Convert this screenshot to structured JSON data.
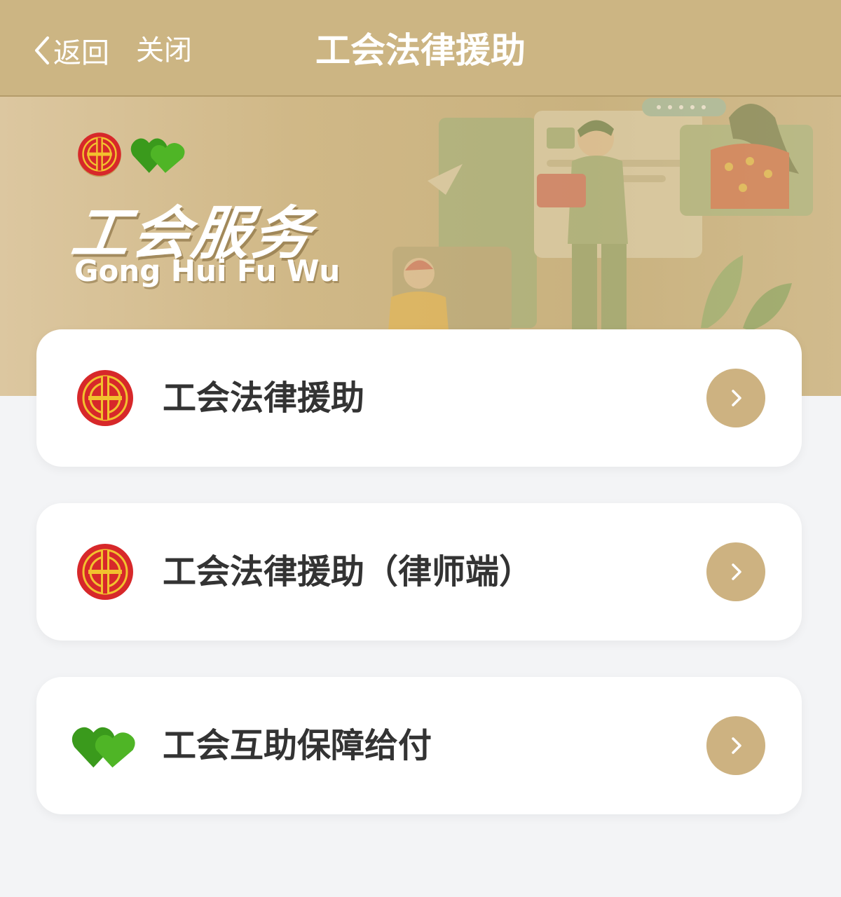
{
  "nav": {
    "back_label": "返回",
    "close_label": "关闭",
    "title": "工会法律援助"
  },
  "banner": {
    "title": "工会服务",
    "subtitle": "Gong Hui Fu Wu"
  },
  "menu": [
    {
      "label": "工会法律援助",
      "icon": "union-emblem-icon"
    },
    {
      "label": "工会法律援助（律师端）",
      "icon": "union-emblem-icon"
    },
    {
      "label": "工会互助保障给付",
      "icon": "green-hearts-icon"
    }
  ],
  "colors": {
    "header_bg": "#ccb583",
    "accent": "#cdb281",
    "emblem_red": "#d7282a",
    "emblem_gold": "#f2c12e",
    "heart_green": "#3a9a1c",
    "page_bg": "#f3f4f6"
  }
}
